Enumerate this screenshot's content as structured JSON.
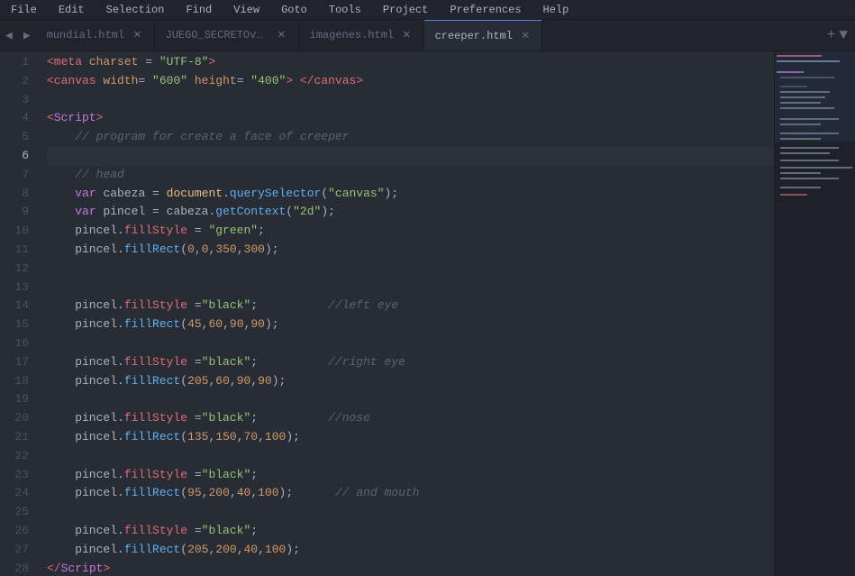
{
  "menubar": {
    "items": [
      "File",
      "Edit",
      "Selection",
      "Find",
      "View",
      "Goto",
      "Tools",
      "Project",
      "Preferences",
      "Help"
    ]
  },
  "tabs": [
    {
      "id": "tab1",
      "label": "mundial.html",
      "active": false
    },
    {
      "id": "tab2",
      "label": "JUEGO_SECRETOv4.html",
      "active": false
    },
    {
      "id": "tab3",
      "label": "imagenes.html",
      "active": false
    },
    {
      "id": "tab4",
      "label": "creeper.html",
      "active": true
    }
  ],
  "editor": {
    "filename": "creeper.html",
    "active_line": 6,
    "lines": [
      {
        "num": 1,
        "content": "meta_charset"
      },
      {
        "num": 2,
        "content": "canvas_tag"
      },
      {
        "num": 3,
        "content": ""
      },
      {
        "num": 4,
        "content": "script_open"
      },
      {
        "num": 5,
        "content": "comment_program"
      },
      {
        "num": 6,
        "content": ""
      },
      {
        "num": 7,
        "content": "comment_head"
      },
      {
        "num": 8,
        "content": "var_cabeza"
      },
      {
        "num": 9,
        "content": "var_pincel"
      },
      {
        "num": 10,
        "content": "pincel_fillstyle_green"
      },
      {
        "num": 11,
        "content": "pincel_fillrect_350_300"
      },
      {
        "num": 12,
        "content": ""
      },
      {
        "num": 13,
        "content": ""
      },
      {
        "num": 14,
        "content": "fillstyle_black_left_eye"
      },
      {
        "num": 15,
        "content": "fillrect_45_60_90_90"
      },
      {
        "num": 16,
        "content": ""
      },
      {
        "num": 17,
        "content": "fillstyle_black_right_eye"
      },
      {
        "num": 18,
        "content": "fillrect_205_60_90_90"
      },
      {
        "num": 19,
        "content": ""
      },
      {
        "num": 20,
        "content": "fillstyle_black_nose"
      },
      {
        "num": 21,
        "content": "fillrect_135_150_70_100"
      },
      {
        "num": 22,
        "content": ""
      },
      {
        "num": 23,
        "content": "fillstyle_black_mouth"
      },
      {
        "num": 24,
        "content": "fillrect_95_200_40_100_mouth"
      },
      {
        "num": 25,
        "content": ""
      },
      {
        "num": 26,
        "content": "fillstyle_black_26"
      },
      {
        "num": 27,
        "content": "fillrect_205_200_40_100"
      },
      {
        "num": 28,
        "content": "script_close"
      }
    ]
  }
}
